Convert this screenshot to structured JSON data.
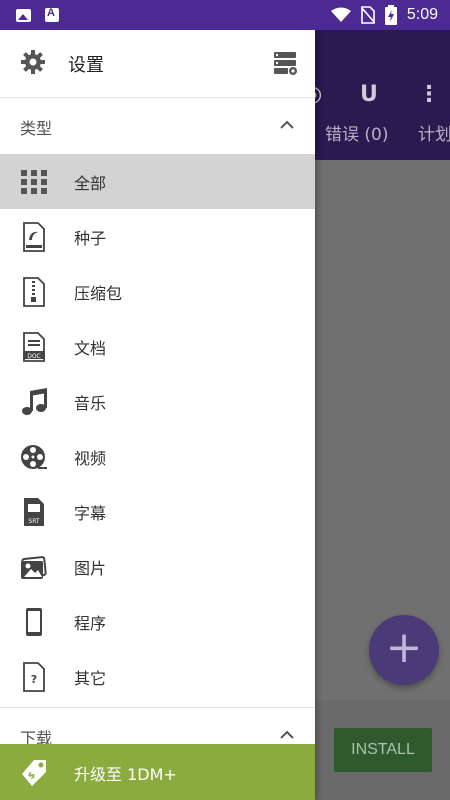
{
  "status_bar": {
    "time": "5:09",
    "icons": [
      "image-icon",
      "a-app-icon",
      "wifi-icon",
      "no-sim-icon",
      "battery-charging-icon"
    ]
  },
  "app": {
    "tabs_visible": [
      "错误 (0)",
      "计划"
    ],
    "install_label": "INSTALL",
    "fab_label": "+"
  },
  "drawer": {
    "settings_label": "设置",
    "types_section": "类型",
    "items": [
      {
        "label": "全部",
        "icon": "grid-icon",
        "selected": true
      },
      {
        "label": "种子",
        "icon": "torrent-file-icon",
        "selected": false
      },
      {
        "label": "压缩包",
        "icon": "zip-file-icon",
        "selected": false
      },
      {
        "label": "文档",
        "icon": "doc-file-icon",
        "selected": false
      },
      {
        "label": "音乐",
        "icon": "music-note-icon",
        "selected": false
      },
      {
        "label": "视频",
        "icon": "film-reel-icon",
        "selected": false
      },
      {
        "label": "字幕",
        "icon": "subtitle-file-icon",
        "selected": false
      },
      {
        "label": "图片",
        "icon": "picture-icon",
        "selected": false
      },
      {
        "label": "程序",
        "icon": "phone-icon",
        "selected": false
      },
      {
        "label": "其它",
        "icon": "unknown-file-icon",
        "selected": false
      }
    ],
    "downloads_section": "下载",
    "upgrade_label": "升级至 1DM+"
  },
  "colors": {
    "status_bar": "#4d2a93",
    "upgrade_bar": "#8bab3f",
    "selected_row": "#d3d3d3"
  }
}
